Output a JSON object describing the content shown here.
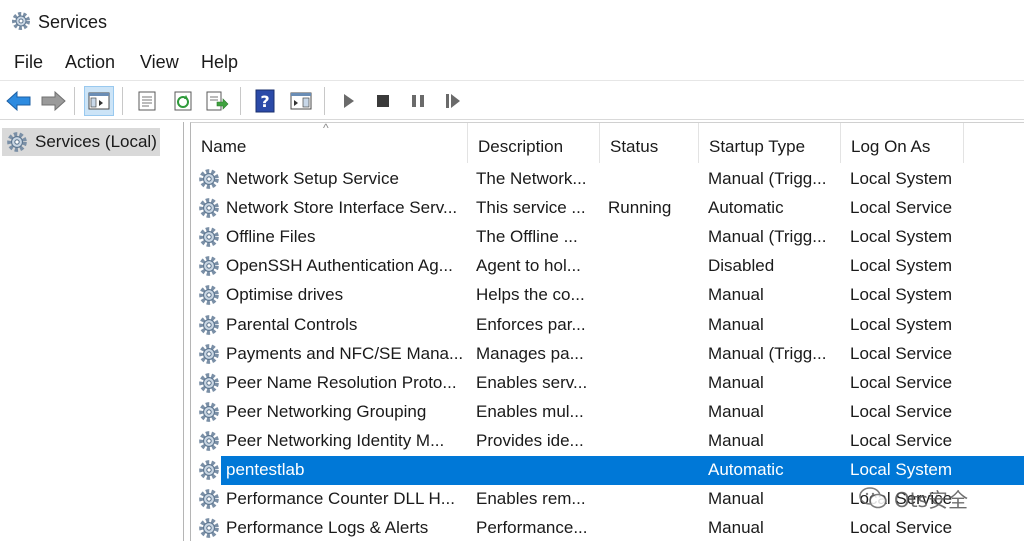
{
  "window": {
    "title": "Services"
  },
  "menu": {
    "items": [
      "File",
      "Action",
      "View",
      "Help"
    ]
  },
  "toolbar": {
    "icons": [
      "back-arrow-icon",
      "forward-arrow-icon",
      "show-hide-console-tree-icon",
      "properties-icon",
      "refresh-icon",
      "export-list-icon",
      "help-icon",
      "action-pane-icon",
      "start-service-icon",
      "stop-service-icon",
      "pause-service-icon",
      "restart-service-icon"
    ]
  },
  "tree": {
    "root_label": "Services (Local)"
  },
  "columns": {
    "name": "Name",
    "description": "Description",
    "status": "Status",
    "startup": "Startup Type",
    "logon": "Log On As"
  },
  "rows": [
    {
      "name": "Network Setup Service",
      "description": "The Network...",
      "status": "",
      "startup": "Manual (Trigg...",
      "logon": "Local System"
    },
    {
      "name": "Network Store Interface Serv...",
      "description": "This service ...",
      "status": "Running",
      "startup": "Automatic",
      "logon": "Local Service"
    },
    {
      "name": "Offline Files",
      "description": "The Offline ...",
      "status": "",
      "startup": "Manual (Trigg...",
      "logon": "Local System"
    },
    {
      "name": "OpenSSH Authentication Ag...",
      "description": "Agent to hol...",
      "status": "",
      "startup": "Disabled",
      "logon": "Local System"
    },
    {
      "name": "Optimise drives",
      "description": "Helps the co...",
      "status": "",
      "startup": "Manual",
      "logon": "Local System"
    },
    {
      "name": "Parental Controls",
      "description": "Enforces par...",
      "status": "",
      "startup": "Manual",
      "logon": "Local System"
    },
    {
      "name": "Payments and NFC/SE Mana...",
      "description": "Manages pa...",
      "status": "",
      "startup": "Manual (Trigg...",
      "logon": "Local Service"
    },
    {
      "name": "Peer Name Resolution Proto...",
      "description": "Enables serv...",
      "status": "",
      "startup": "Manual",
      "logon": "Local Service"
    },
    {
      "name": "Peer Networking Grouping",
      "description": "Enables mul...",
      "status": "",
      "startup": "Manual",
      "logon": "Local Service"
    },
    {
      "name": "Peer Networking Identity M...",
      "description": "Provides ide...",
      "status": "",
      "startup": "Manual",
      "logon": "Local Service"
    },
    {
      "name": "pentestlab",
      "description": "",
      "status": "",
      "startup": "Automatic",
      "logon": "Local System"
    },
    {
      "name": "Performance Counter DLL H...",
      "description": "Enables rem...",
      "status": "",
      "startup": "Manual",
      "logon": "Local Service"
    },
    {
      "name": "Performance Logs & Alerts",
      "description": "Performance...",
      "status": "",
      "startup": "Manual",
      "logon": "Local Service"
    }
  ],
  "selected_row": "pentestlab",
  "watermark": {
    "text": "Ots安全"
  },
  "colors": {
    "selection": "#0078d7",
    "tree_selected": "#d9d9d9",
    "accent_blue": "#0078d7"
  }
}
